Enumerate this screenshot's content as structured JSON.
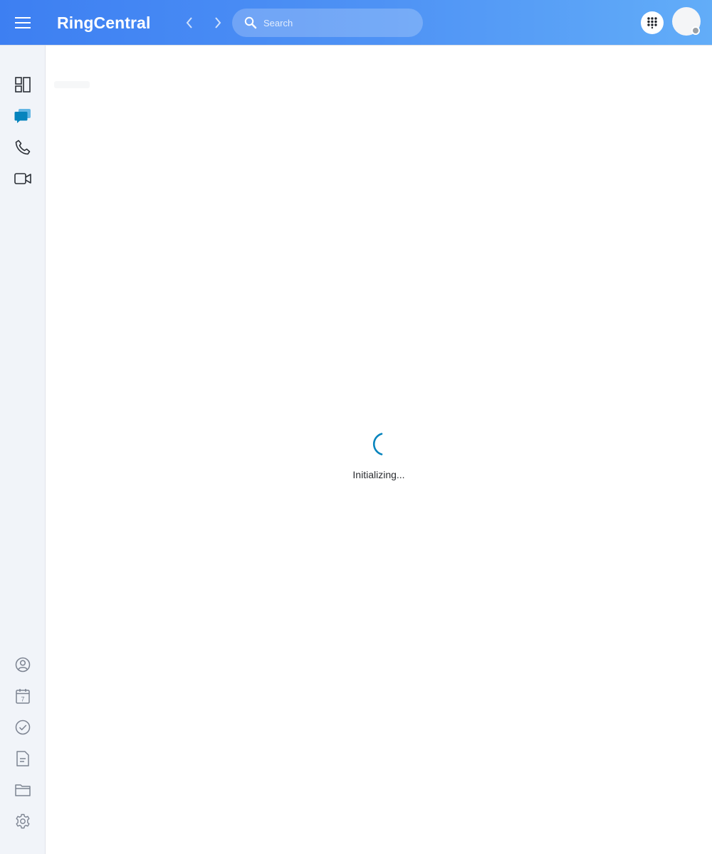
{
  "header": {
    "brand": "RingCentral",
    "search": {
      "placeholder": "Search",
      "value": ""
    },
    "icons": {
      "menu": "hamburger-menu-icon",
      "back": "chevron-left-icon",
      "forward": "chevron-right-icon",
      "search": "search-icon",
      "dialpad": "dialpad-icon"
    },
    "presence_color": "#9aa0a6"
  },
  "sidebar": {
    "top_items": [
      {
        "id": "dashboard",
        "icon": "dashboard-icon",
        "active": false
      },
      {
        "id": "messages",
        "icon": "message-icon",
        "active": true
      },
      {
        "id": "phone",
        "icon": "phone-icon",
        "active": false
      },
      {
        "id": "video",
        "icon": "video-icon",
        "active": false
      }
    ],
    "bottom_items": [
      {
        "id": "contacts",
        "icon": "contacts-icon"
      },
      {
        "id": "calendar",
        "icon": "calendar-icon",
        "day": "7"
      },
      {
        "id": "tasks",
        "icon": "tasks-icon"
      },
      {
        "id": "notes",
        "icon": "notes-icon"
      },
      {
        "id": "files",
        "icon": "folder-icon"
      },
      {
        "id": "settings",
        "icon": "settings-icon"
      }
    ]
  },
  "main": {
    "status_text": "Initializing..."
  },
  "colors": {
    "accent": "#0684bd",
    "header_gradient_start": "#3d7ff2",
    "header_gradient_end": "#62adf8"
  }
}
